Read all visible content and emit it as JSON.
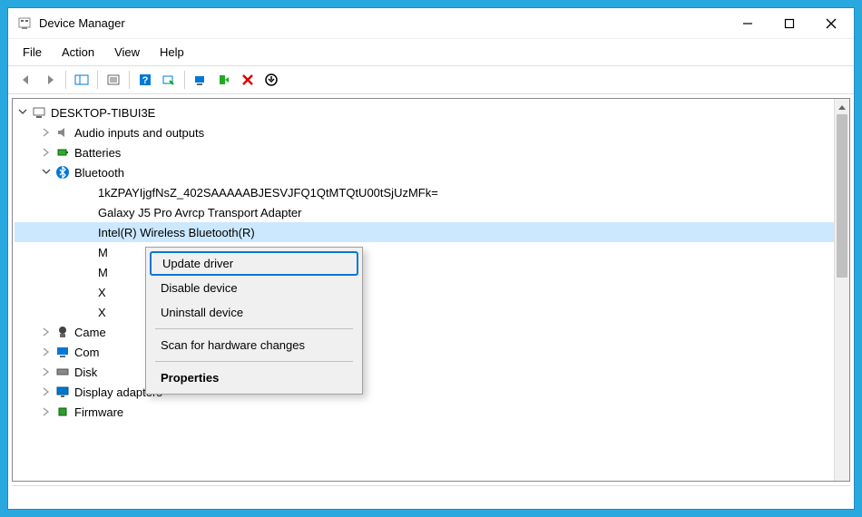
{
  "window": {
    "title": "Device Manager"
  },
  "menus": {
    "file": "File",
    "action": "Action",
    "view": "View",
    "help": "Help"
  },
  "tree": {
    "root": "DESKTOP-TIBUI3E",
    "audio": "Audio inputs and outputs",
    "batteries": "Batteries",
    "bluetooth": "Bluetooth",
    "bt_dev1": "1kZPAYIjgfNsZ_402SAAAAABJESVJFQ1QtMTQtU00tSjUzMFk=",
    "bt_dev2": "Galaxy J5 Pro Avrcp Transport Adapter",
    "bt_dev3": "Intel(R) Wireless Bluetooth(R)",
    "bt_m1": "M",
    "bt_m2": "M",
    "bt_x1": "X",
    "bt_x2": "X",
    "cameras": "Came",
    "computer": "Com",
    "disk": "Disk",
    "display": "Display adapters",
    "firmware": "Firmware"
  },
  "context_menu": {
    "update": "Update driver",
    "disable": "Disable device",
    "uninstall": "Uninstall device",
    "scan": "Scan for hardware changes",
    "properties": "Properties"
  }
}
